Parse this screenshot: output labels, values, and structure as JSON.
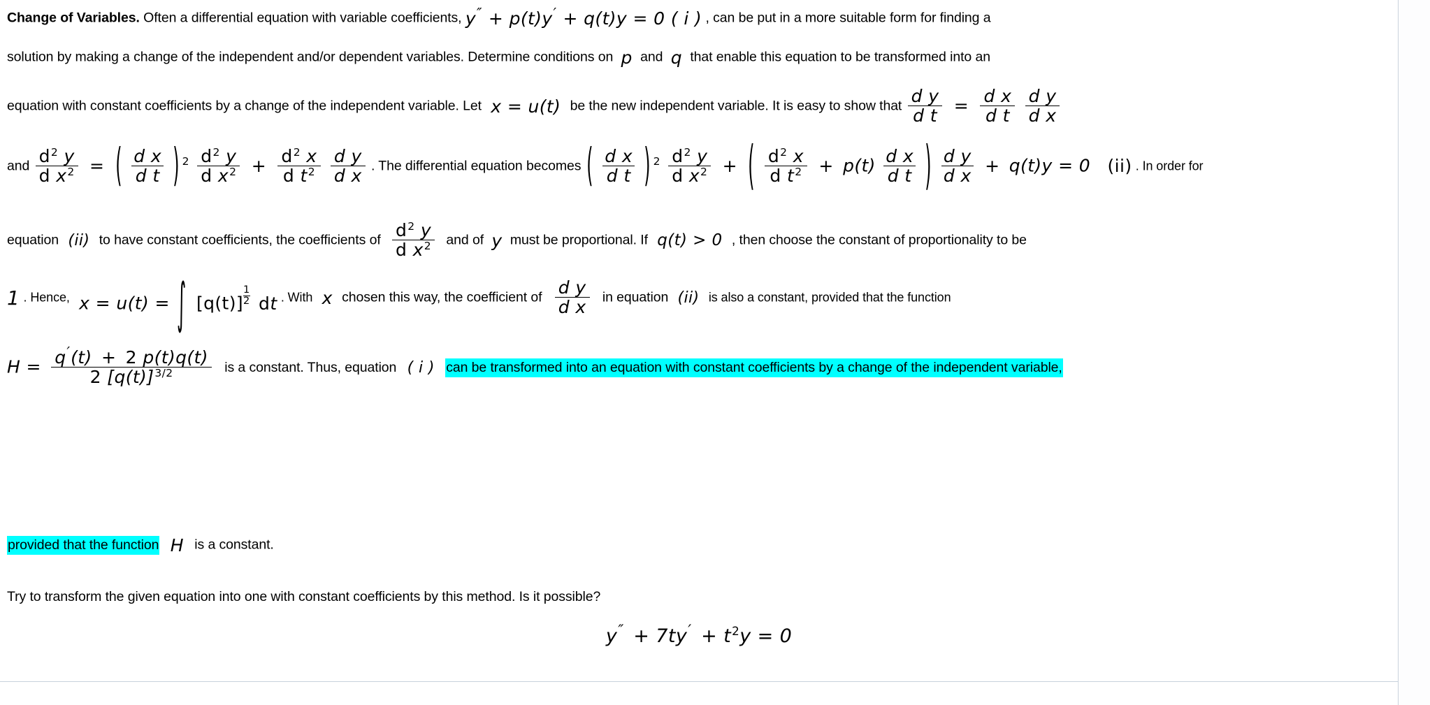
{
  "document": {
    "title_lead": "Change of Variables.",
    "highlight_color": "#00ffff",
    "background_color": "#ffffff",
    "text_color": "#000000"
  },
  "paragraph": {
    "l1_a": "Often a differential equation with variable coefficients,",
    "l1_math_y": "y",
    "l1_math_rest": "+ p(t)y",
    "l1_math_rest2": "+ q(t)y = 0 ( i )",
    "l1_b": ", can be put in a more suitable form for finding a",
    "l2_a": "solution by making a change of the independent and/or dependent variables. Determine conditions on",
    "l2_p": "p",
    "l2_and": "and",
    "l2_q": "q",
    "l2_b": "that enable this equation to be transformed into an",
    "l3_a": "equation with constant coefficients by a change of the independent variable. Let",
    "l3_math": "x = u(t)",
    "l3_b": "be the new independent variable. It is easy to show that",
    "l4_and": "and",
    "l4_mid": ". The differential equation becomes",
    "l4_tag": "(ii)",
    "l4_end": ". In order for",
    "l5_a": "equation",
    "l5_tag": "(ii)",
    "l5_b": "to have constant coefficients, the coefficients of",
    "l5_c": "and of",
    "l5_y": "y",
    "l5_d": "must be proportional. If",
    "l5_cond": "q(t) > 0",
    "l5_e": ", then choose the constant of proportionality to be",
    "l6_one": "1",
    "l6_hence": ". Hence,",
    "l6_x": "x = u(t) =",
    "l6_brack_open": "[q(t)]",
    "l6_dt": "dt",
    "l6_with": ". With",
    "l6_xvar": "x",
    "l6_b": "chosen this way, the coefficient of",
    "l6_c": "in equation",
    "l6_tag": "(ii)",
    "l6_d": "is also a constant, provided that the function",
    "l7_H": "H =",
    "l7_num": "q (t) + 2 p(t)q(t)",
    "l7_den_a": "2 [q(t)]",
    "l7_den_sup": "3/2",
    "l7_b": "is a constant. Thus, equation",
    "l7_tag": "( i )",
    "l7_highlight": "can be transformed into an equation with constant coefficients by a change of the independent variable,",
    "l8_highlight": "provided that the function",
    "l8_H": "H",
    "l8_b": "is a constant.",
    "l9": "Try to transform the given equation into one with constant coefficients by this method. Is it possible?"
  },
  "final_equation": {
    "y": "y",
    "primes": "′′",
    "term2": "+ 7ty",
    "prime2": "′",
    "term3": "+ t",
    "exp3": "2",
    "term4": "y = 0"
  },
  "fractions": {
    "dy_dt": {
      "num": "d y",
      "den": "d t"
    },
    "dx_dt": {
      "num": "d x",
      "den": "d t"
    },
    "dy_dx": {
      "num": "d y",
      "den": "d x"
    },
    "d2y_dx2_num": "d y",
    "d2y_dx2_den": "d x",
    "d2x_dt2_num": "d x",
    "d2x_dt2_den": "d t",
    "exp_two": "2"
  }
}
